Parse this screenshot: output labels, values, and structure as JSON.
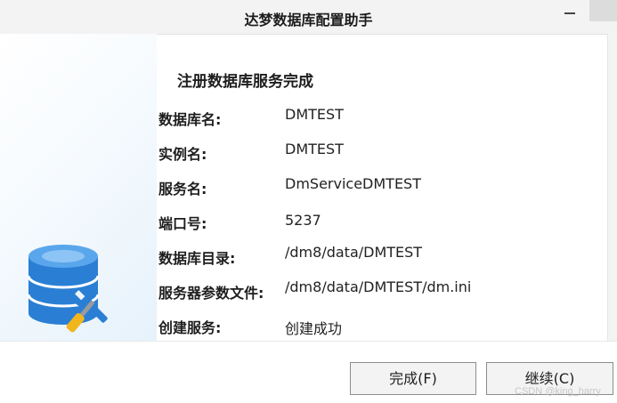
{
  "window": {
    "title": "达梦数据库配置助手"
  },
  "main": {
    "heading": "注册数据库服务完成",
    "rows": [
      {
        "label": "数据库名:",
        "value": "DMTEST"
      },
      {
        "label": "实例名:",
        "value": "DMTEST"
      },
      {
        "label": "服务名:",
        "value": "DmServiceDMTEST"
      },
      {
        "label": "端口号:",
        "value": "5237"
      },
      {
        "label": "数据库目录:",
        "value": "/dm8/data/DMTEST"
      },
      {
        "label": "服务器参数文件:",
        "value": "/dm8/data/DMTEST/dm.ini"
      },
      {
        "label": "创建服务:",
        "value": "创建成功"
      }
    ]
  },
  "footer": {
    "finish_label": "完成(F)",
    "continue_label": "继续(C)"
  },
  "watermark": "CSDN @king_harry",
  "colors": {
    "accent": "#2a7fd4",
    "tool_yellow": "#f2b61c"
  },
  "icons": {
    "illustration": "database-config-icon",
    "window_close": "close-icon",
    "window_minimize": "minimize-icon"
  }
}
